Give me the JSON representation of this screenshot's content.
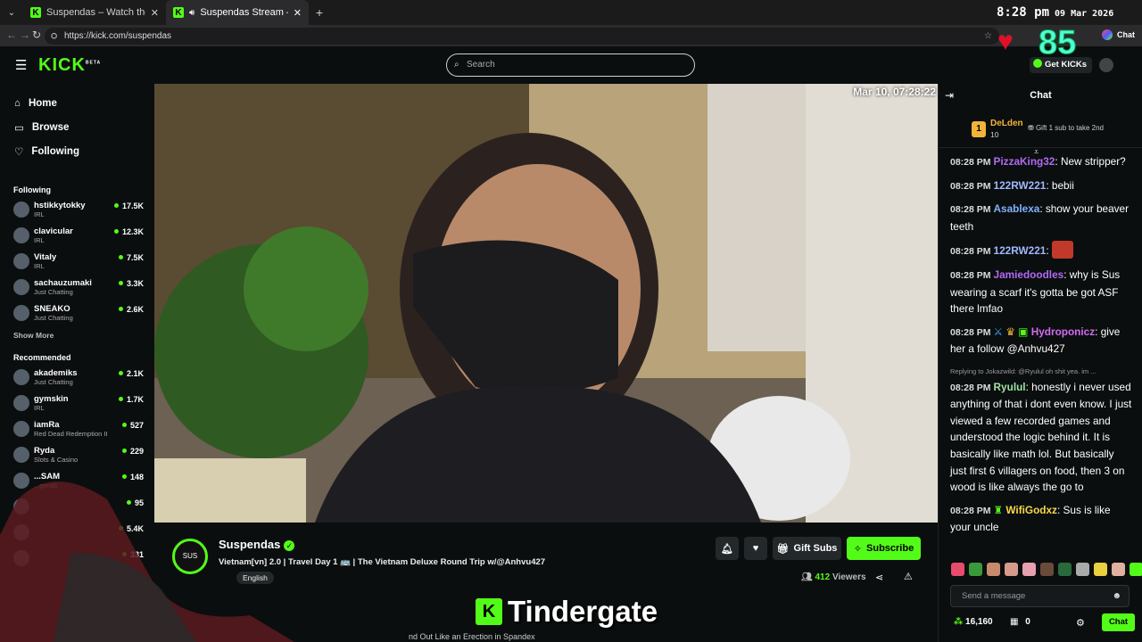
{
  "browser": {
    "tabs": [
      {
        "title": "Suspendas – Watch the VOD on Kick",
        "active": false
      },
      {
        "title": "Suspendas Stream – Watch Live on Kick",
        "active": true
      }
    ],
    "url": "https://kick.com/suspendas",
    "chat_ext_label": "Chat"
  },
  "clock": {
    "time": "8:28 pm",
    "date": "09 Mar 2026"
  },
  "overlay": {
    "counter": "85",
    "caption": "Tindergate",
    "bottom_text": "nd Out Like an Erection in Spandex"
  },
  "header": {
    "logo": "KICK",
    "logo_badge": "BETA",
    "search_placeholder": "Search",
    "get_kicks": "Get KICKs"
  },
  "sidebar": {
    "nav": [
      {
        "label": "Home"
      },
      {
        "label": "Browse"
      },
      {
        "label": "Following"
      }
    ],
    "following_title": "Following",
    "following": [
      {
        "name": "hstikkytokky",
        "category": "IRL",
        "viewers": "17.5K"
      },
      {
        "name": "clavicular",
        "category": "IRL",
        "viewers": "12.3K"
      },
      {
        "name": "Vitaly",
        "category": "IRL",
        "viewers": "7.5K"
      },
      {
        "name": "sachauzumaki",
        "category": "Just Chatting",
        "viewers": "3.3K"
      },
      {
        "name": "SNEAKO",
        "category": "Just Chatting",
        "viewers": "2.6K"
      }
    ],
    "show_more": "Show More",
    "recommended_title": "Recommended",
    "recommended": [
      {
        "name": "akademiks",
        "category": "Just Chatting",
        "viewers": "2.1K"
      },
      {
        "name": "gymskin",
        "category": "IRL",
        "viewers": "1.7K"
      },
      {
        "name": "iamRa",
        "category": "Red Dead Redemption II",
        "viewers": "527"
      },
      {
        "name": "Ryda",
        "category": "Slots & Casino",
        "viewers": "229"
      },
      {
        "name": "...SAM",
        "category": "...gends",
        "viewers": "148"
      },
      {
        "name": "",
        "category": "",
        "viewers": "95"
      },
      {
        "name": "",
        "category": "",
        "viewers": "5.4K"
      },
      {
        "name": "",
        "category": "",
        "viewers": "331"
      }
    ]
  },
  "video": {
    "timestamp": "Mar 10, 07:28:22"
  },
  "stream": {
    "channel": "Suspendas",
    "title": "Vietnam[vn] 2.0 | Travel Day 1 🚌 | The Vietnam Deluxe Round Trip w/@Anhvu427",
    "language": "English",
    "viewer_count": "412",
    "viewer_label": "Viewers",
    "gift_subs": "Gift Subs",
    "subscribe": "Subscribe"
  },
  "chat": {
    "title": "Chat",
    "pinned": {
      "rank": "1",
      "user": "DeLden",
      "amount": "10",
      "gift_text": "Gift 1 sub to take 2nd"
    },
    "messages": [
      {
        "time": "08:28 PM",
        "user": "PizzaKing32",
        "color": "#b26af2",
        "text": "New stripper?"
      },
      {
        "time": "08:28 PM",
        "user": "122RW221",
        "color": "#a0b7ff",
        "text": "bebii"
      },
      {
        "time": "08:28 PM",
        "user": "Asablexa",
        "color": "#7fb2ff",
        "text": "show your beaver teeth"
      },
      {
        "time": "08:28 PM",
        "user": "122RW221",
        "color": "#a0b7ff",
        "text": ""
      },
      {
        "time": "08:28 PM",
        "user": "Jamiedoodles",
        "color": "#b26af2",
        "text": "why is Sus wearing a scarf it's gotta be got ASF there lmfao"
      },
      {
        "time": "08:28 PM",
        "user": "Hydroponicz",
        "color": "#d36bf2",
        "text": "give her a follow @Anhvu427"
      },
      {
        "time": "08:28 PM",
        "user": "Ryulul",
        "color": "#9fe0a0",
        "text": "honestly i never used anything of that i dont even know. I just viewed a few recorded games and understood the logic behind it. It is basically like math lol. But basically just first 6 villagers on food, then 3 on wood is like always the go to",
        "reply": "Replying to Jokazwild: @Ryulul oh shit yea. im ..."
      },
      {
        "time": "08:28 PM",
        "user": "WifiGodxz",
        "color": "#f7d84a",
        "text": "Sus is like your uncle"
      }
    ],
    "input_placeholder": "Send a message",
    "kicks_balance": "16,160",
    "gift_count": "0",
    "send_label": "Chat"
  }
}
